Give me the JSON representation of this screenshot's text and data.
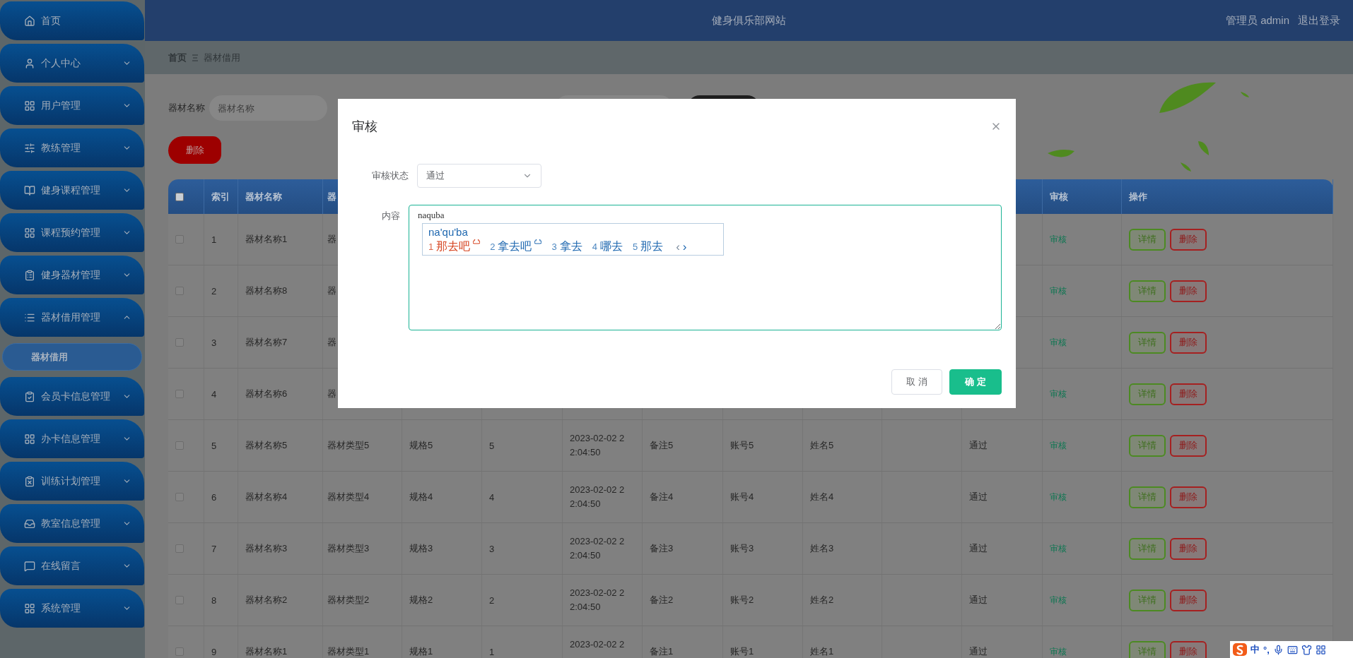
{
  "header": {
    "title": "健身俱乐部网站",
    "user": "管理员 admin",
    "logout": "退出登录"
  },
  "sidebar": {
    "items": [
      {
        "kind": "link",
        "label": "首页"
      },
      {
        "kind": "menu",
        "label": "个人中心",
        "expanded": false
      },
      {
        "kind": "menu",
        "label": "用户管理",
        "expanded": false
      },
      {
        "kind": "menu",
        "label": "教练管理",
        "expanded": false
      },
      {
        "kind": "menu",
        "label": "健身课程管理",
        "expanded": false
      },
      {
        "kind": "menu",
        "label": "课程预约管理",
        "expanded": false
      },
      {
        "kind": "menu",
        "label": "健身器材管理",
        "expanded": false
      },
      {
        "kind": "menu",
        "label": "器材借用管理",
        "expanded": true,
        "children": [
          {
            "label": "器材借用",
            "selected": true
          }
        ]
      },
      {
        "kind": "menu",
        "label": "会员卡信息管理",
        "expanded": false
      },
      {
        "kind": "menu",
        "label": "办卡信息管理",
        "expanded": false
      },
      {
        "kind": "menu",
        "label": "训练计划管理",
        "expanded": false
      },
      {
        "kind": "menu",
        "label": "教室信息管理",
        "expanded": false
      },
      {
        "kind": "menu",
        "label": "在线留言",
        "expanded": false
      },
      {
        "kind": "menu",
        "label": "系统管理",
        "expanded": false
      }
    ]
  },
  "breadcrumb": {
    "home": "首页",
    "current": "器材借用"
  },
  "search": {
    "label": "器材名称",
    "placeholder": "器材名称"
  },
  "delete_button": "删除",
  "table": {
    "header_checked": false,
    "columns": {
      "index": "索引",
      "name": "器材名称",
      "type": "器",
      "review": "审核",
      "actions": "操作"
    },
    "rows": [
      {
        "checked": false,
        "index": "1",
        "name": "器材名称1",
        "type": "器",
        "review": "审核",
        "actions": [
          "详情",
          "删除"
        ]
      },
      {
        "checked": false,
        "index": "2",
        "name": "器材名称8",
        "type": "器",
        "review": "审核",
        "actions": [
          "详情",
          "删除"
        ]
      },
      {
        "checked": false,
        "index": "3",
        "name": "器材名称7",
        "type": "器",
        "review": "审核",
        "actions": [
          "详情",
          "删除"
        ]
      },
      {
        "checked": false,
        "index": "4",
        "name": "器材名称6",
        "type": "器",
        "review": "审核",
        "actions": [
          "详情",
          "删除"
        ]
      },
      {
        "checked": false,
        "index": "5",
        "name": "器材名称5",
        "type": "器材类型5",
        "spec": "规格5",
        "qty": "5",
        "date": "2023-02-02 22:04:50",
        "remark": "备注5",
        "account": "账号5",
        "person": "姓名5",
        "status": "通过",
        "review": "审核",
        "actions": [
          "详情",
          "删除"
        ]
      },
      {
        "checked": false,
        "index": "6",
        "name": "器材名称4",
        "type": "器材类型4",
        "spec": "规格4",
        "qty": "4",
        "date": "2023-02-02 22:04:50",
        "remark": "备注4",
        "account": "账号4",
        "person": "姓名4",
        "status": "通过",
        "review": "审核",
        "actions": [
          "详情",
          "删除"
        ]
      },
      {
        "checked": false,
        "index": "7",
        "name": "器材名称3",
        "type": "器材类型3",
        "spec": "规格3",
        "qty": "3",
        "date": "2023-02-02 22:04:50",
        "remark": "备注3",
        "account": "账号3",
        "person": "姓名3",
        "status": "通过",
        "review": "审核",
        "actions": [
          "详情",
          "删除"
        ]
      },
      {
        "checked": false,
        "index": "8",
        "name": "器材名称2",
        "type": "器材类型2",
        "spec": "规格2",
        "qty": "2",
        "date": "2023-02-02 22:04:50",
        "remark": "备注2",
        "account": "账号2",
        "person": "姓名2",
        "status": "通过",
        "review": "审核",
        "actions": [
          "详情",
          "删除"
        ]
      },
      {
        "checked": false,
        "index": "9",
        "name": "器材名称1",
        "type": "器材类型1",
        "spec": "规格1",
        "qty": "1",
        "date": "2023-02-02 2",
        "remark": "备注1",
        "account": "账号1",
        "person": "姓名1",
        "status": "通过",
        "review": "审核",
        "actions": [
          "详情",
          "删除"
        ]
      }
    ]
  },
  "dialog": {
    "title": "审核",
    "status_label": "审核状态",
    "status_value": "通过",
    "content_label": "内容",
    "content_value": "naquba",
    "cancel": "取 消",
    "confirm": "确 定"
  },
  "ime": {
    "composition": "na'qu'ba",
    "candidates": [
      {
        "number": "1",
        "text": "那去吧",
        "selected": true,
        "cloud": true
      },
      {
        "number": "2",
        "text": "拿去吧",
        "selected": false,
        "cloud": true
      },
      {
        "number": "3",
        "text": "拿去",
        "selected": false,
        "cloud": false
      },
      {
        "number": "4",
        "text": "哪去",
        "selected": false,
        "cloud": false
      },
      {
        "number": "5",
        "text": "那去",
        "selected": false,
        "cloud": false
      }
    ],
    "prev": {
      "label": "‹",
      "disabled": true
    },
    "next": {
      "label": "›",
      "disabled": false
    }
  },
  "ime_toolbar": {
    "mode": "中",
    "punctuation": "°,"
  }
}
